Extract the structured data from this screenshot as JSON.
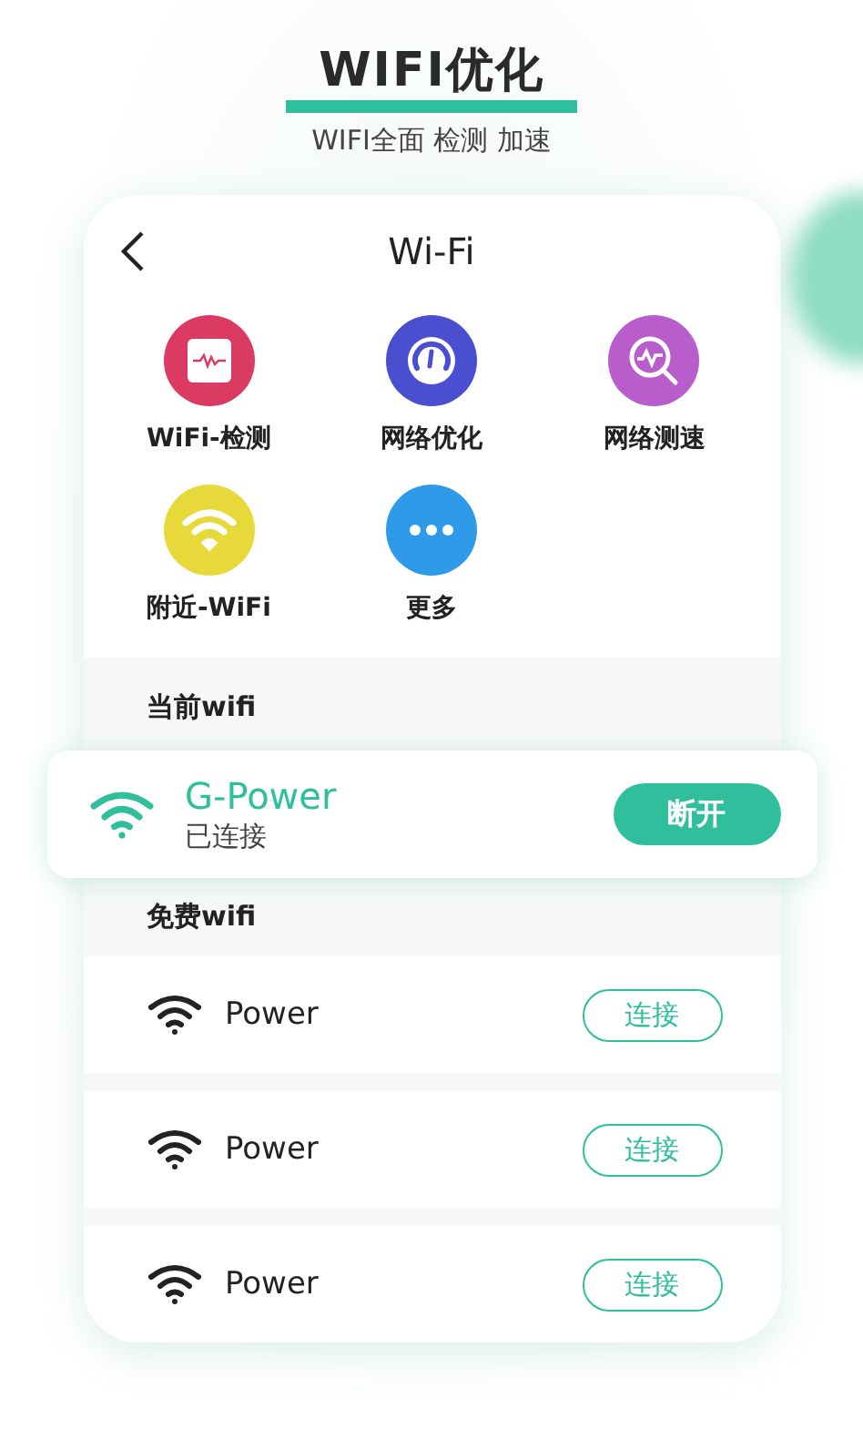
{
  "header": {
    "title": "WIFI优化",
    "subtitle": "WIFI全面 检测 加速"
  },
  "panel": {
    "title": "Wi-Fi",
    "tools": [
      {
        "label": "WiFi-检测",
        "kind": "monitor",
        "color": "#db3a62"
      },
      {
        "label": "网络优化",
        "kind": "gauge",
        "color": "#4a4fcf"
      },
      {
        "label": "网络测速",
        "kind": "speed",
        "color": "#b95ccc"
      },
      {
        "label": "附近-WiFi",
        "kind": "wifi",
        "color": "#e8d93a"
      },
      {
        "label": "更多",
        "kind": "more",
        "color": "#2f9be8"
      }
    ],
    "current_label": "当前wifi",
    "current": {
      "name": "G-Power",
      "status": "已连接",
      "action": "断开"
    },
    "free_label": "免费wifi",
    "networks": [
      {
        "name": "Power",
        "action": "连接"
      },
      {
        "name": "Power",
        "action": "连接"
      },
      {
        "name": "Power",
        "action": "连接"
      }
    ]
  }
}
